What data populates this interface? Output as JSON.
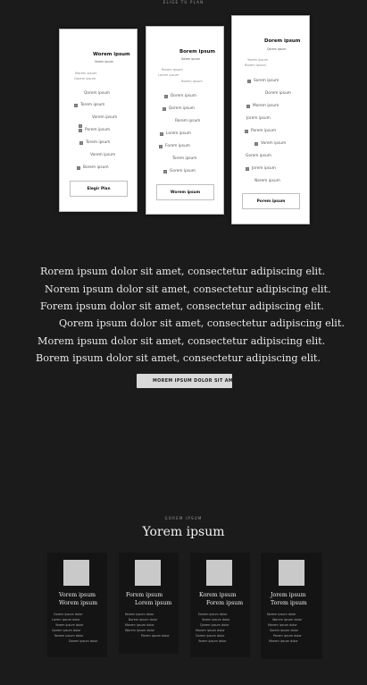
{
  "header": {
    "eyebrow": "ELIGE TU PLAN"
  },
  "plans": [
    {
      "title": "Worem ipsum",
      "subtitle": "Vorem ipsum",
      "intro": [
        "Morem ipsum",
        "Gorem ipsum"
      ],
      "features": [
        "Qorem ipsum",
        "Torem ipsum",
        "Vorem ipsum",
        "Porem ipsum",
        "Torem ipsum",
        "Vorem ipsum",
        "Borem ipsum"
      ],
      "button": "Elegir Plan"
    },
    {
      "title": "Borem ipsum",
      "subtitle": "Sorem ipsum",
      "intro": [
        "Rorem ipsum",
        "Lorem ipsum",
        "Rorem ipsum"
      ],
      "features": [
        "Dorem ipsum",
        "Qorem ipsum",
        "Rorem ipsum",
        "Lorem ipsum",
        "Forem ipsum",
        "Torem ipsum",
        "Gorem ipsum"
      ],
      "button": "Worem ipsum"
    },
    {
      "title": "Dorem ipsum",
      "subtitle": "Qorem ipsum",
      "intro": [
        "Yorem ipsum",
        "Borem ipsum"
      ],
      "features": [
        "Sorem ipsum",
        "Dorem ipsum",
        "Morem ipsum",
        "Jorem ipsum",
        "Porem ipsum",
        "Vorem ipsum",
        "Gorem ipsum",
        "Jorem ipsum",
        "Norem ipsum"
      ],
      "button": "Porem ipsum"
    }
  ],
  "hero": {
    "lines": [
      "Rorem ipsum dolor sit amet, consectetur adipiscing elit.",
      "Norem ipsum dolor sit amet, consectetur adipiscing elit.",
      "Forem ipsum dolor sit amet, consectetur adipiscing elit.",
      "Qorem ipsum dolor sit amet, consectetur adipiscing elit.",
      "Morem ipsum dolor sit amet, consectetur adipiscing elit.",
      "Borem ipsum dolor sit amet, consectetur adipiscing elit."
    ],
    "button": "MOREM IPSUM DOLOR SIT AMET"
  },
  "team": {
    "eyebrow": "GOREM IPSUM",
    "title": "Yorem ipsum",
    "members": [
      {
        "name1": "Vorem ipsum",
        "name2": "Worem ipsum",
        "lines": [
          "Gorem ipsum dolor",
          "Lorem ipsum dolor",
          "Yorem ipsum dolor",
          "Qorem ipsum dolor",
          "Norem ipsum dolor",
          "Dorem ipsum dolor"
        ]
      },
      {
        "name1": "Forem ipsum",
        "name2": "Lorem ipsum",
        "lines": [
          "Norem ipsum dolor",
          "Borem ipsum dolor",
          "Morem ipsum dolor",
          "Worem ipsum dolor",
          "Porem ipsum dolor"
        ]
      },
      {
        "name1": "Korem ipsum",
        "name2": "Forem ipsum",
        "lines": [
          "Dorem ipsum dolor",
          "Yorem ipsum dolor",
          "Qorem ipsum dolor",
          "Morem ipsum dolor",
          "Gorem ipsum dolor",
          "Yorem ipsum dolor"
        ]
      },
      {
        "name1": "Jorem ipsum",
        "name2": "Torem ipsum",
        "lines": [
          "Norem ipsum dolor",
          "Worem ipsum dolor",
          "Morem ipsum dolor",
          "Sorem ipsum dolor",
          "Porem ipsum dolor",
          "Morem ipsum dolor"
        ]
      }
    ]
  }
}
